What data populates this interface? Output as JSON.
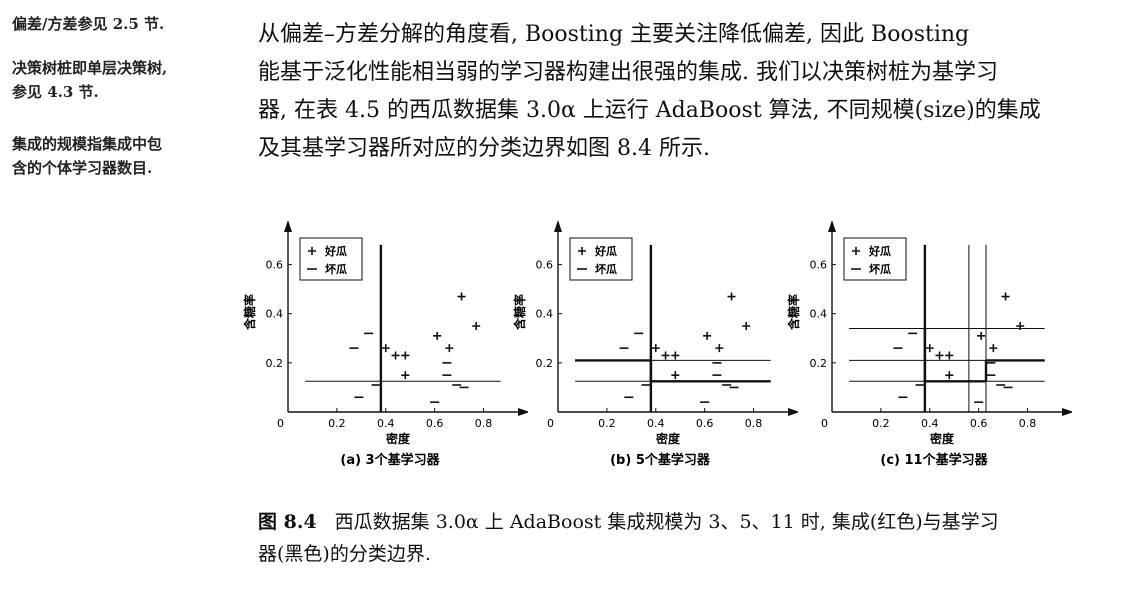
{
  "margin_notes": [
    {
      "lines": [
        "偏差/方差参见 2.5 节."
      ]
    },
    {
      "lines": [
        "决策树桩即单层决策树,",
        "参见 4.3 节."
      ]
    },
    {
      "lines": [
        "集成的规模指集成中包",
        "含的个体学习器数目."
      ]
    }
  ],
  "paragraph": {
    "lines": [
      "从偏差–方差分解的角度看, Boosting 主要关注降低偏差, 因此 Boosting",
      "能基于泛化性能相当弱的学习器构建出很强的集成. 我们以决策树桩为基学习",
      "器, 在表 4.5 的西瓜数据集 3.0α 上运行 AdaBoost 算法, 不同规模(size)的集成",
      "及其基学习器所对应的分类边界如图 8.4 所示."
    ]
  },
  "caption": {
    "label": "图 8.4",
    "lines": [
      "西瓜数据集 3.0α 上 AdaBoost 集成规模为 3、5、11 时, 集成(红色)与基学习",
      "器(黑色)的分类边界."
    ]
  },
  "chart_data": [
    {
      "type": "scatter",
      "subtitle": "(a) 3个基学习器",
      "xlabel": "密度",
      "ylabel": "含糖率",
      "xticks": [
        "0.2",
        "0.4",
        "0.6",
        "0.8"
      ],
      "yticks": [
        "0.2",
        "0.4",
        "0.6"
      ],
      "origin_label": "0",
      "xlim": [
        0.0,
        0.9
      ],
      "ylim": [
        0.0,
        0.7
      ],
      "legend": {
        "position": "top-left",
        "entries": [
          {
            "marker": "+",
            "label": "好瓜"
          },
          {
            "marker": "−",
            "label": "坏瓜"
          }
        ]
      },
      "series": [
        {
          "name": "好瓜",
          "marker": "+",
          "points": [
            [
              0.4,
              0.26
            ],
            [
              0.44,
              0.23
            ],
            [
              0.48,
              0.23
            ],
            [
              0.48,
              0.15
            ],
            [
              0.61,
              0.31
            ],
            [
              0.66,
              0.26
            ],
            [
              0.71,
              0.47
            ],
            [
              0.77,
              0.35
            ]
          ]
        },
        {
          "name": "坏瓜",
          "marker": "−",
          "points": [
            [
              0.27,
              0.26
            ],
            [
              0.33,
              0.32
            ],
            [
              0.29,
              0.06
            ],
            [
              0.36,
              0.11
            ],
            [
              0.6,
              0.04
            ],
            [
              0.65,
              0.2
            ],
            [
              0.65,
              0.15
            ],
            [
              0.69,
              0.11
            ],
            [
              0.72,
              0.1
            ]
          ]
        }
      ],
      "boundaries": [
        {
          "type": "vertical",
          "at": 0.38,
          "range": [
            0.0,
            0.68
          ],
          "weight": "bold"
        },
        {
          "type": "horizontal",
          "at": 0.125,
          "range": [
            0.07,
            0.87
          ],
          "weight": "normal"
        }
      ]
    },
    {
      "type": "scatter",
      "subtitle": "(b) 5个基学习器",
      "xlabel": "密度",
      "ylabel": "含糖率",
      "xticks": [
        "0.2",
        "0.4",
        "0.6",
        "0.8"
      ],
      "yticks": [
        "0.2",
        "0.4",
        "0.6"
      ],
      "origin_label": "0",
      "xlim": [
        0.0,
        0.9
      ],
      "ylim": [
        0.0,
        0.7
      ],
      "legend": {
        "position": "top-left",
        "entries": [
          {
            "marker": "+",
            "label": "好瓜"
          },
          {
            "marker": "−",
            "label": "坏瓜"
          }
        ]
      },
      "series": [
        {
          "name": "好瓜",
          "marker": "+",
          "points": [
            [
              0.4,
              0.26
            ],
            [
              0.44,
              0.23
            ],
            [
              0.48,
              0.23
            ],
            [
              0.48,
              0.15
            ],
            [
              0.61,
              0.31
            ],
            [
              0.66,
              0.26
            ],
            [
              0.71,
              0.47
            ],
            [
              0.77,
              0.35
            ]
          ]
        },
        {
          "name": "坏瓜",
          "marker": "−",
          "points": [
            [
              0.27,
              0.26
            ],
            [
              0.33,
              0.32
            ],
            [
              0.29,
              0.06
            ],
            [
              0.36,
              0.11
            ],
            [
              0.6,
              0.04
            ],
            [
              0.65,
              0.2
            ],
            [
              0.65,
              0.15
            ],
            [
              0.69,
              0.11
            ],
            [
              0.72,
              0.1
            ]
          ]
        }
      ],
      "boundaries": [
        {
          "type": "vertical",
          "at": 0.38,
          "range": [
            0.0,
            0.68
          ],
          "weight": "bold"
        },
        {
          "type": "horizontal",
          "at": 0.21,
          "range": [
            0.07,
            0.87
          ],
          "weight": "normal"
        },
        {
          "type": "horizontal",
          "at": 0.125,
          "range": [
            0.07,
            0.87
          ],
          "weight": "normal"
        },
        {
          "type": "horizontal",
          "at": 0.21,
          "range": [
            0.07,
            0.38
          ],
          "weight": "bold"
        },
        {
          "type": "horizontal",
          "at": 0.125,
          "range": [
            0.38,
            0.87
          ],
          "weight": "bold"
        },
        {
          "type": "vertical",
          "at": 0.38,
          "range": [
            0.125,
            0.21
          ],
          "weight": "bold"
        }
      ]
    },
    {
      "type": "scatter",
      "subtitle": "(c) 11个基学习器",
      "xlabel": "密度",
      "ylabel": "含糖率",
      "xticks": [
        "0.2",
        "0.4",
        "0.6",
        "0.8"
      ],
      "yticks": [
        "0.2",
        "0.4",
        "0.6"
      ],
      "origin_label": "0",
      "xlim": [
        0.0,
        0.9
      ],
      "ylim": [
        0.0,
        0.7
      ],
      "legend": {
        "position": "top-left",
        "entries": [
          {
            "marker": "+",
            "label": "好瓜"
          },
          {
            "marker": "−",
            "label": "坏瓜"
          }
        ]
      },
      "series": [
        {
          "name": "好瓜",
          "marker": "+",
          "points": [
            [
              0.4,
              0.26
            ],
            [
              0.44,
              0.23
            ],
            [
              0.48,
              0.23
            ],
            [
              0.48,
              0.15
            ],
            [
              0.61,
              0.31
            ],
            [
              0.66,
              0.26
            ],
            [
              0.71,
              0.47
            ],
            [
              0.77,
              0.35
            ]
          ]
        },
        {
          "name": "坏瓜",
          "marker": "−",
          "points": [
            [
              0.27,
              0.26
            ],
            [
              0.33,
              0.32
            ],
            [
              0.29,
              0.06
            ],
            [
              0.36,
              0.11
            ],
            [
              0.6,
              0.04
            ],
            [
              0.65,
              0.2
            ],
            [
              0.65,
              0.15
            ],
            [
              0.69,
              0.11
            ],
            [
              0.72,
              0.1
            ]
          ]
        }
      ],
      "boundaries": [
        {
          "type": "vertical",
          "at": 0.38,
          "range": [
            0.0,
            0.68
          ],
          "weight": "bold"
        },
        {
          "type": "vertical",
          "at": 0.56,
          "range": [
            0.0,
            0.68
          ],
          "weight": "normal"
        },
        {
          "type": "vertical",
          "at": 0.63,
          "range": [
            0.0,
            0.68
          ],
          "weight": "normal"
        },
        {
          "type": "horizontal",
          "at": 0.34,
          "range": [
            0.07,
            0.87
          ],
          "weight": "normal"
        },
        {
          "type": "horizontal",
          "at": 0.21,
          "range": [
            0.07,
            0.87
          ],
          "weight": "normal"
        },
        {
          "type": "horizontal",
          "at": 0.125,
          "range": [
            0.07,
            0.87
          ],
          "weight": "normal"
        },
        {
          "type": "vertical",
          "at": 0.38,
          "range": [
            0.125,
            0.34
          ],
          "weight": "bold"
        },
        {
          "type": "horizontal",
          "at": 0.125,
          "range": [
            0.38,
            0.63
          ],
          "weight": "bold"
        },
        {
          "type": "horizontal",
          "at": 0.21,
          "range": [
            0.63,
            0.87
          ],
          "weight": "bold"
        },
        {
          "type": "vertical",
          "at": 0.63,
          "range": [
            0.125,
            0.21
          ],
          "weight": "bold"
        }
      ]
    }
  ]
}
